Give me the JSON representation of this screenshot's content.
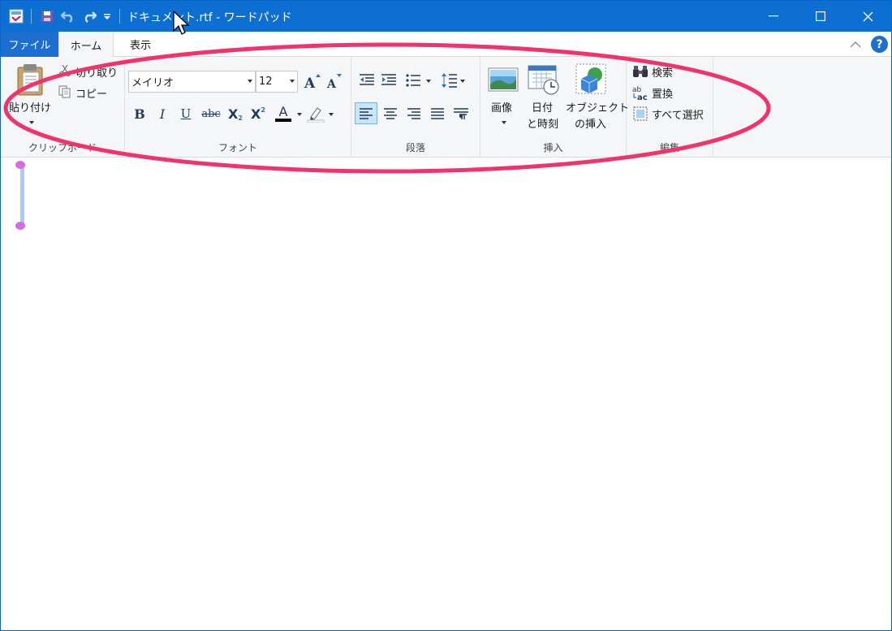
{
  "window": {
    "title": "ドキュメント.rtf - ワードパッド"
  },
  "quick_access": {
    "icons": [
      "wordpad-app-icon",
      "save-icon",
      "undo-icon",
      "redo-icon",
      "customize-dropdown-icon"
    ]
  },
  "menu": {
    "tabs": [
      {
        "label": "ファイル"
      },
      {
        "label": "ホーム"
      },
      {
        "label": "表示"
      }
    ],
    "active_tab": "ホーム",
    "help_label": "?"
  },
  "ribbon": {
    "clipboard": {
      "label": "クリップボード",
      "paste": "貼り付け",
      "cut": "切り取り",
      "copy": "コピー"
    },
    "font": {
      "label": "フォント",
      "family": "メイリオ",
      "size": "12",
      "bold": "B",
      "italic": "I",
      "underline": "U",
      "strike": "abc",
      "subscript": "X",
      "superscript": "X",
      "font_color_letter": "A"
    },
    "paragraph": {
      "label": "段落"
    },
    "insert": {
      "label": "挿入",
      "picture": "画像",
      "datetime_line1": "日付",
      "datetime_line2": "と時刻",
      "object_line1": "オブジェクト",
      "object_line2": "の挿入"
    },
    "editing": {
      "label": "編集",
      "find": "検索",
      "replace": "置換",
      "select_all": "すべて選択"
    }
  },
  "colors": {
    "titlebar": "#0d6fd1",
    "highlight_ellipse": "#f0336a",
    "caret_handle": "#d76be6"
  }
}
